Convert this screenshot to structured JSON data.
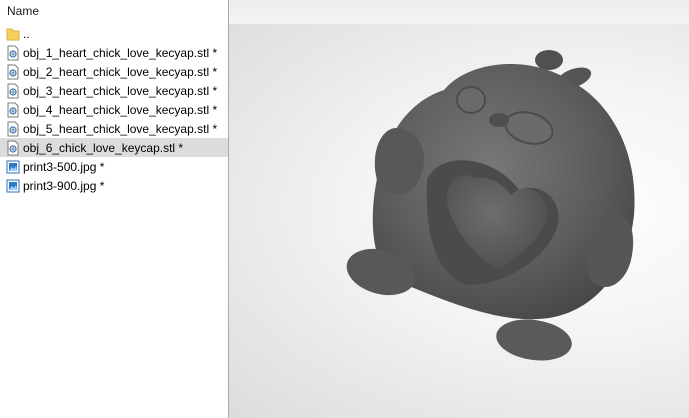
{
  "explorer": {
    "column_header": "Name",
    "items": [
      {
        "name": "..",
        "icon": "folder-icon",
        "selected": false
      },
      {
        "name": "obj_1_heart_chick_love_kecyap.stl *",
        "icon": "stl-file-icon",
        "selected": false
      },
      {
        "name": "obj_2_heart_chick_love_kecyap.stl *",
        "icon": "stl-file-icon",
        "selected": false
      },
      {
        "name": "obj_3_heart_chick_love_kecyap.stl *",
        "icon": "stl-file-icon",
        "selected": false
      },
      {
        "name": "obj_4_heart_chick_love_kecyap.stl *",
        "icon": "stl-file-icon",
        "selected": false
      },
      {
        "name": "obj_5_heart_chick_love_kecyap.stl *",
        "icon": "stl-file-icon",
        "selected": false
      },
      {
        "name": "obj_6_chick_love_keycap.stl *",
        "icon": "stl-file-icon",
        "selected": true
      },
      {
        "name": "print3-500.jpg *",
        "icon": "image-file-icon",
        "selected": false
      },
      {
        "name": "print3-900.jpg *",
        "icon": "image-file-icon",
        "selected": false
      }
    ]
  },
  "preview": {
    "model_icon": "chick-keycap-3d-model",
    "model_color": "#5f5f5f"
  }
}
